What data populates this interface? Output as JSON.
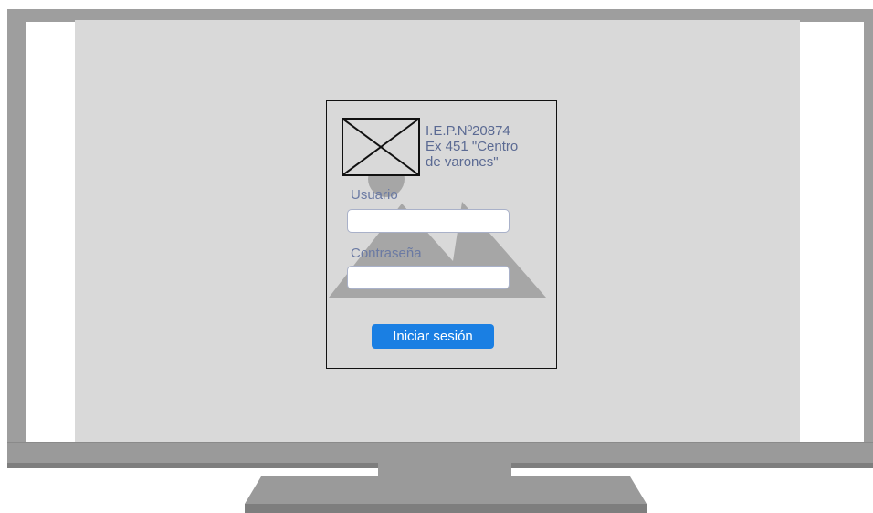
{
  "login": {
    "school_name": "I.E.P.Nº20874\nEx 451 \"Centro\nde varones\"",
    "username_label": "Usuario",
    "username_value": "",
    "password_label": "Contraseña",
    "password_value": "",
    "submit_label": "Iniciar sesión"
  },
  "icons": {
    "logo": "image-placeholder-icon",
    "background": "image-placeholder-icon"
  },
  "colors": {
    "screen_background": "#d9d9d9",
    "monitor_frame": "#9e9e9e",
    "text_accent": "#5b6a93",
    "button": "#1a7fe3",
    "button_text": "#ffffff"
  }
}
